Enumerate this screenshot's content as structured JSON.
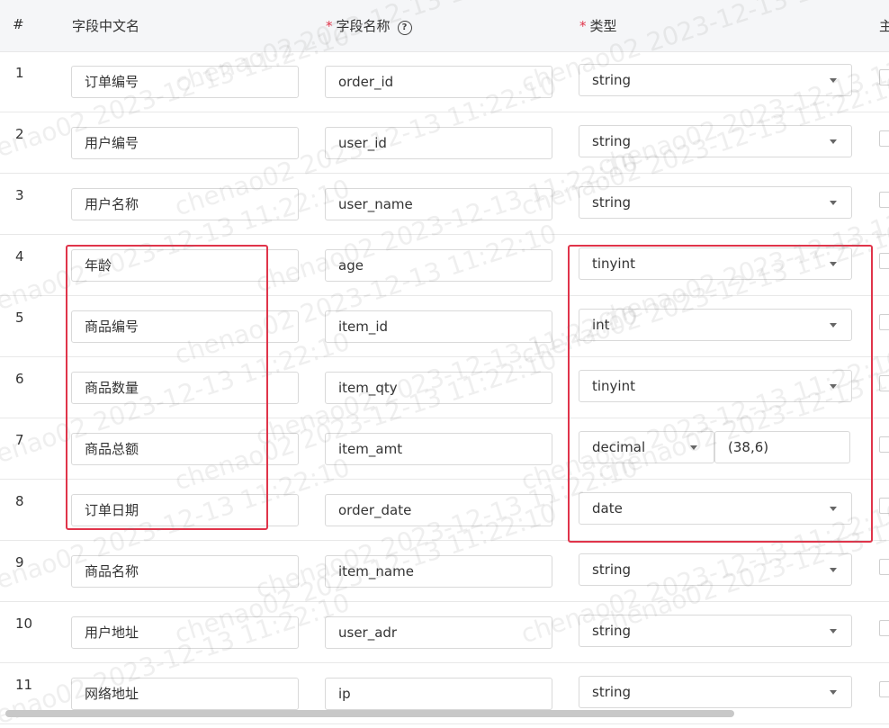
{
  "header": {
    "index": "#",
    "chinese_name": "字段中文名",
    "field_name": "字段名称",
    "type": "类型",
    "next_column_partial": "主",
    "required_mark": "*",
    "help_icon": "?"
  },
  "rows": [
    {
      "index": "1",
      "cn": "订单编号",
      "name": "order_id",
      "type": "string"
    },
    {
      "index": "2",
      "cn": "用户编号",
      "name": "user_id",
      "type": "string"
    },
    {
      "index": "3",
      "cn": "用户名称",
      "name": "user_name",
      "type": "string"
    },
    {
      "index": "4",
      "cn": "年龄",
      "name": "age",
      "type": "tinyint"
    },
    {
      "index": "5",
      "cn": "商品编号",
      "name": "item_id",
      "type": "int"
    },
    {
      "index": "6",
      "cn": "商品数量",
      "name": "item_qty",
      "type": "tinyint"
    },
    {
      "index": "7",
      "cn": "商品总额",
      "name": "item_amt",
      "type": "decimal",
      "precision": "(38,6)"
    },
    {
      "index": "8",
      "cn": "订单日期",
      "name": "order_date",
      "type": "date"
    },
    {
      "index": "9",
      "cn": "商品名称",
      "name": "item_name",
      "type": "string"
    },
    {
      "index": "10",
      "cn": "用户地址",
      "name": "user_adr",
      "type": "string"
    },
    {
      "index": "11",
      "cn": "网络地址",
      "name": "ip",
      "type": "string"
    }
  ],
  "watermark": {
    "user": "chenao02 2023-12-13 11:22:10"
  },
  "colors": {
    "highlight": "#e0344a",
    "header_bg": "#f5f6f8"
  }
}
